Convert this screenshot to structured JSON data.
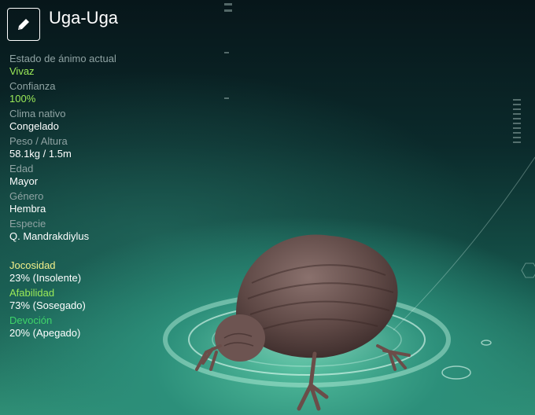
{
  "creature": {
    "name": "Uga-Uga"
  },
  "stats": [
    {
      "label": "Estado de ánimo actual",
      "value": "Vivaz",
      "accent": true
    },
    {
      "label": "Confianza",
      "value": "100%",
      "accent": true
    },
    {
      "label": "Clima nativo",
      "value": "Congelado"
    },
    {
      "label": "Peso / Altura",
      "value": "58.1kg / 1.5m"
    },
    {
      "label": "Edad",
      "value": "Mayor"
    },
    {
      "label": "Género",
      "value": "Hembra"
    },
    {
      "label": "Especie",
      "value": "Q. Mandrakdiylus"
    }
  ],
  "traits": [
    {
      "label": "Jocosidad",
      "value": "23% (Insolente)",
      "color": "#f3f08a"
    },
    {
      "label": "Afabilidad",
      "value": "73% (Sosegado)",
      "color": "#9bea58"
    },
    {
      "label": "Devoción",
      "value": "20% (Apegado)",
      "color": "#3fd46a"
    }
  ],
  "icons": {
    "edit": "pencil-icon"
  },
  "colors": {
    "accent_green": "#9bea58",
    "label_gray": "#8fa3a3"
  }
}
